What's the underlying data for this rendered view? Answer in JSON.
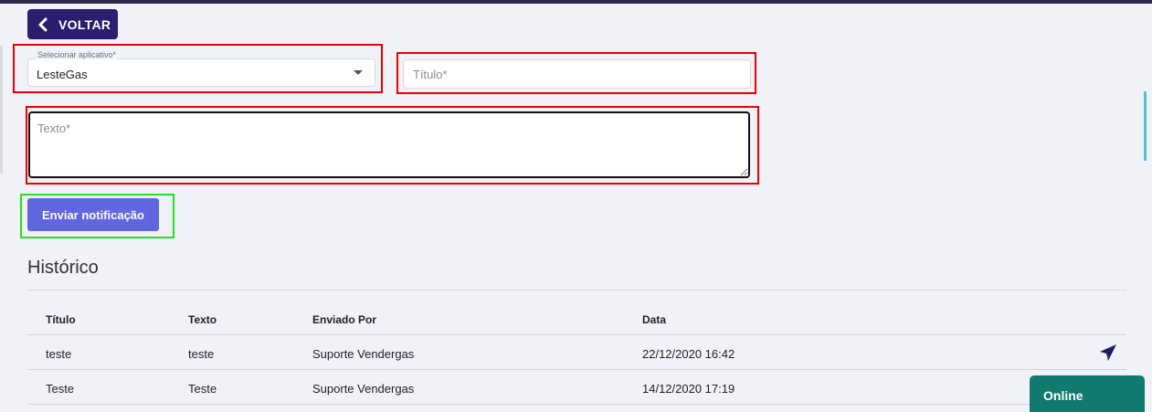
{
  "nav": {
    "back_label": "VOLTAR"
  },
  "form": {
    "app_select": {
      "label": "Selecionar aplicativo*",
      "value": "LesteGas"
    },
    "title": {
      "placeholder": "Título*",
      "value": ""
    },
    "text": {
      "placeholder": "Texto*",
      "value": ""
    },
    "submit_label": "Enviar notificação"
  },
  "history": {
    "title": "Histórico",
    "columns": [
      "Título",
      "Texto",
      "Enviado Por",
      "Data"
    ],
    "rows": [
      {
        "titulo": "teste",
        "texto": "teste",
        "enviado_por": "Suporte Vendergas",
        "data": "22/12/2020 16:42",
        "action_icon": "send-plane-icon"
      },
      {
        "titulo": "Teste",
        "texto": "Teste",
        "enviado_por": "Suporte Vendergas",
        "data": "14/12/2020 17:19"
      }
    ]
  },
  "chat": {
    "status_label": "Online"
  },
  "colors": {
    "accent": "#6066e0",
    "back_button": "#2a1f6e",
    "highlight_red": "#ee0000",
    "highlight_green": "#1ee51e",
    "online_badge": "#0f7a6d"
  }
}
